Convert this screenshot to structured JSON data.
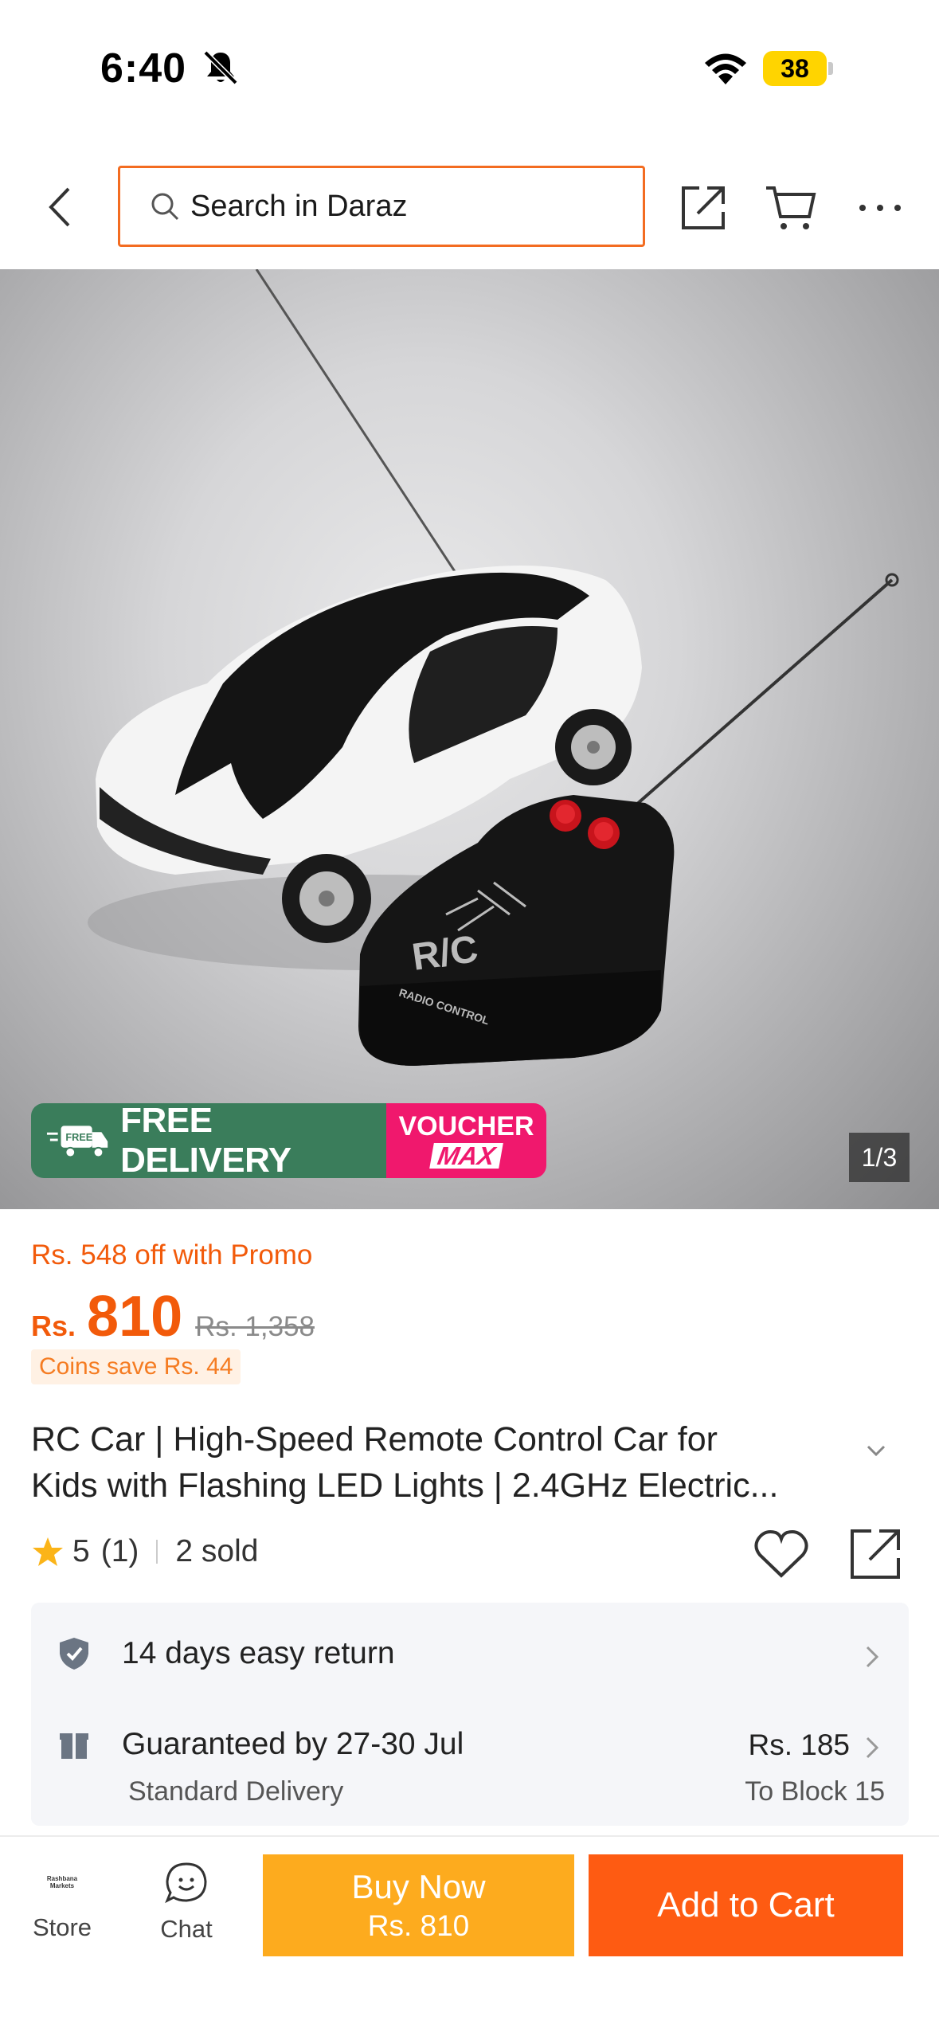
{
  "status_bar": {
    "time": "6:40",
    "battery": "38"
  },
  "header": {
    "search_placeholder": "Search in Daraz"
  },
  "image": {
    "counter": "1/3",
    "free_delivery": "FREE DELIVERY",
    "free_tag": "FREE",
    "voucher_top": "VOUCHER",
    "voucher_bottom": "MAX",
    "remote_label": "R/C",
    "remote_sub": "RADIO CONTROL"
  },
  "pricing": {
    "promo": "Rs. 548 off with Promo",
    "currency": "Rs.",
    "price": "810",
    "original": "Rs. 1,358",
    "coins": "Coins save Rs. 44"
  },
  "product": {
    "title_line1": "RC Car | High-Speed Remote Control Car for",
    "title_line2": "Kids with Flashing LED Lights | 2.4GHz Electric...",
    "rating": "5",
    "rating_count": "(1)",
    "sold": "2 sold"
  },
  "info": {
    "return": "14 days easy return",
    "guarantee": "Guaranteed by 27-30 Jul",
    "delivery_type": "Standard Delivery",
    "ship_price": "Rs. 185",
    "ship_to": "To Block 15"
  },
  "bottom": {
    "store_logo": "Rashbana Markets",
    "store": "Store",
    "chat": "Chat",
    "buy_now": "Buy Now",
    "buy_price": "Rs. 810",
    "add_to_cart": "Add to Cart"
  },
  "colors": {
    "accent": "#f36c21",
    "price": "#f25a0a",
    "buy_now": "#fdab1e",
    "add_to_cart": "#fe5b12",
    "free_delivery": "#3a7d5b",
    "voucher": "#f0186d"
  }
}
